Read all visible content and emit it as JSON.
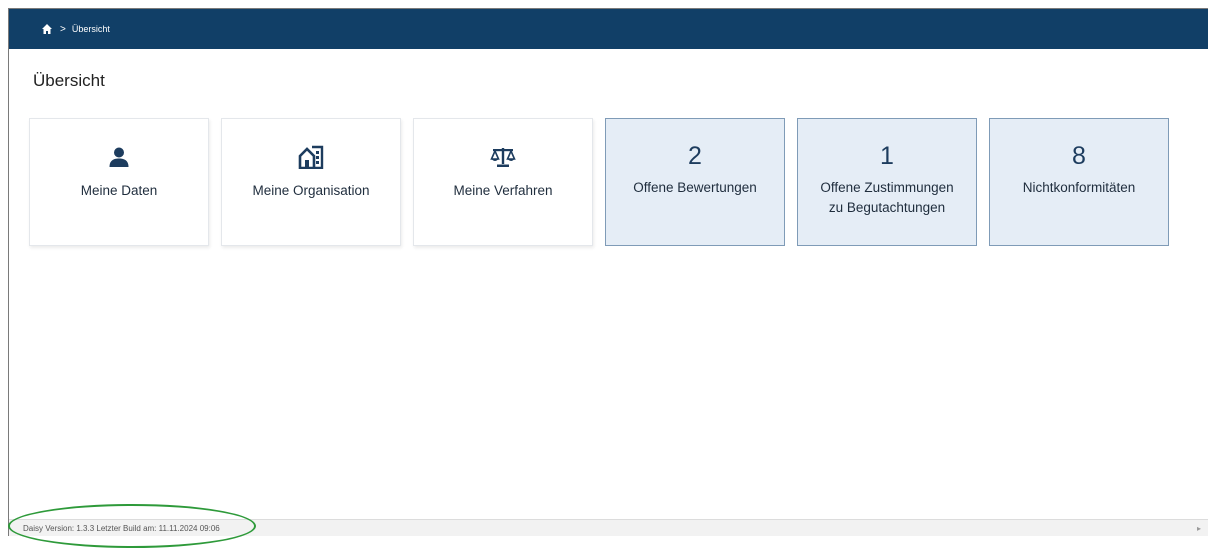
{
  "breadcrumb": {
    "separator": ">",
    "current": "Übersicht"
  },
  "page": {
    "title": "Übersicht"
  },
  "tiles": [
    {
      "label": "Meine Daten",
      "icon": "person-icon"
    },
    {
      "label": "Meine Organisation",
      "icon": "building-icon"
    },
    {
      "label": "Meine Verfahren",
      "icon": "scales-icon"
    }
  ],
  "stats": [
    {
      "count": "2",
      "label": "Offene Bewertungen"
    },
    {
      "count": "1",
      "label": "Offene Zustimmungen zu Begutachtungen"
    },
    {
      "count": "8",
      "label": "Nichtkonformitäten"
    }
  ],
  "footer": {
    "version_text": "Daisy Version: 1.3.3 Letzter Build am: 11.11.2024 09:06"
  },
  "colors": {
    "header": "#113f67",
    "stat_tile_bg": "#e5edf6",
    "stat_tile_border": "#7f9bb7",
    "annotation": "#2e9a3a"
  }
}
